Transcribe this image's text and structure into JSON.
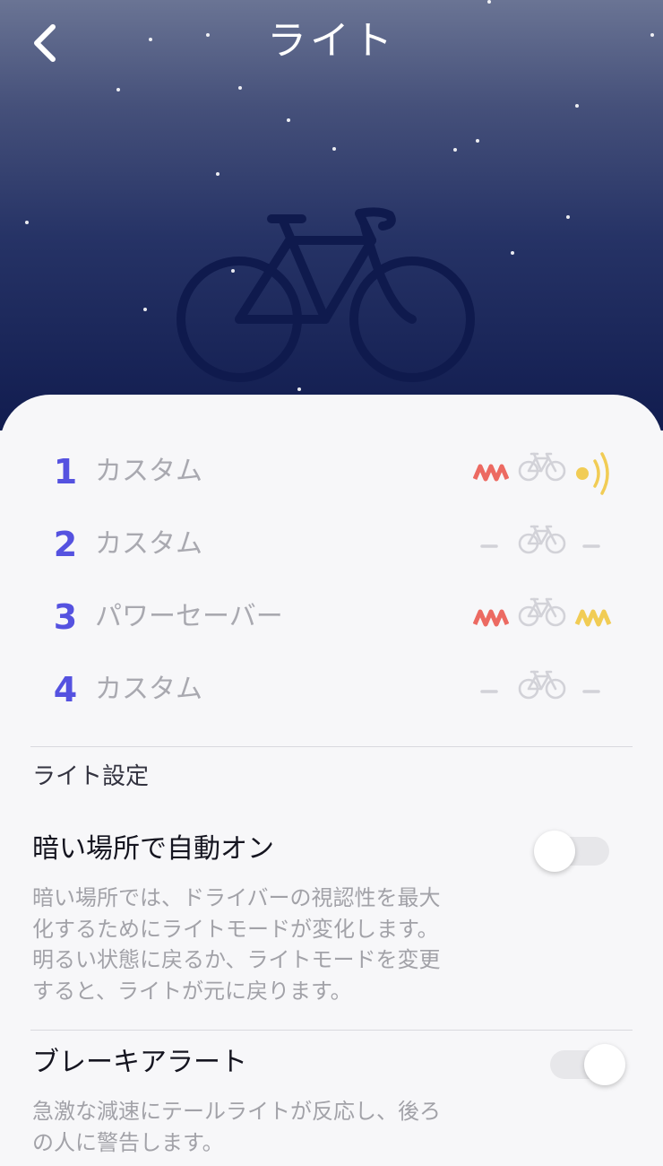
{
  "header": {
    "title": "ライト"
  },
  "modes": [
    {
      "number": "1",
      "name": "カスタム",
      "front": "flash",
      "rear": "signal"
    },
    {
      "number": "2",
      "name": "カスタム",
      "front": "off",
      "rear": "off"
    },
    {
      "number": "3",
      "name": "パワーセーバー",
      "front": "flash",
      "rear": "flash"
    },
    {
      "number": "4",
      "name": "カスタム",
      "front": "off",
      "rear": "off"
    }
  ],
  "colors": {
    "accent": "#5552e0",
    "front_light": "#ec6a62",
    "rear_light": "#f1cc55",
    "bike_icon": "#d2d2d8"
  },
  "settings": {
    "section_title": "ライト設定",
    "auto_on": {
      "title": "暗い場所で自動オン",
      "description_lines": [
        "暗い場所では、ドライバーの視認性を最大",
        "化するためにライトモードが変化します。",
        "明るい状態に戻るか、ライトモードを変更",
        "すると、ライトが元に戻ります。"
      ],
      "enabled": false
    },
    "brake_alert": {
      "title": "ブレーキアラート",
      "description_lines": [
        "急激な減速にテールライトが反応し、後ろ",
        "の人に警告します。"
      ],
      "enabled": true
    }
  }
}
